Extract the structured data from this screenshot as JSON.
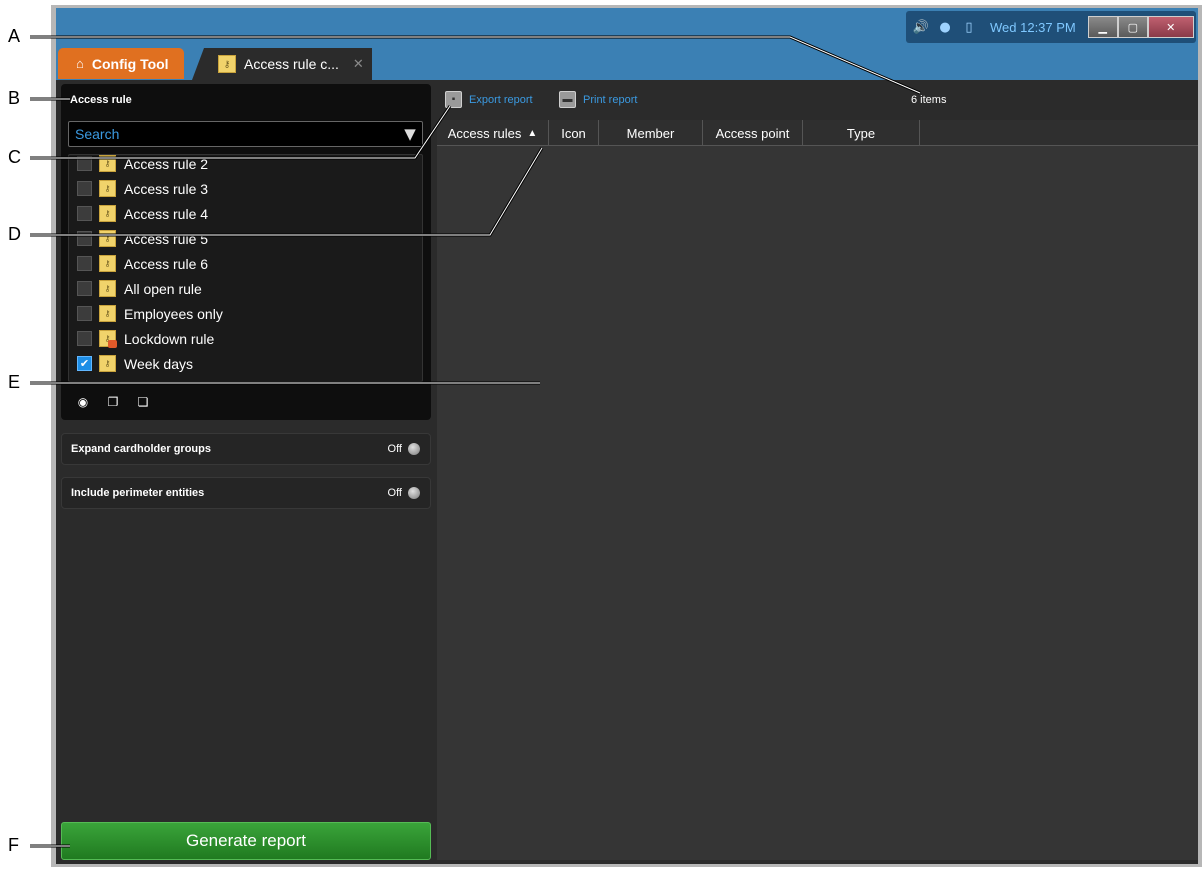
{
  "callouts": [
    "A",
    "B",
    "C",
    "D",
    "E",
    "F"
  ],
  "system": {
    "clock": "Wed 12:37 PM"
  },
  "tabs": {
    "home_label": "Config Tool",
    "task_label": "Access rule c...",
    "close_glyph": "✕"
  },
  "left": {
    "section_title": "Access rule",
    "search_placeholder": "Search",
    "rules": [
      {
        "label": "Access rule 2",
        "checked": false
      },
      {
        "label": "Access rule 3",
        "checked": false
      },
      {
        "label": "Access rule 4",
        "checked": false
      },
      {
        "label": "Access rule 5",
        "checked": false
      },
      {
        "label": "Access rule 6",
        "checked": false
      },
      {
        "label": "All open rule",
        "checked": false
      },
      {
        "label": "Employees only",
        "checked": false
      },
      {
        "label": "Lockdown rule",
        "checked": false
      },
      {
        "label": "Week days",
        "checked": true
      }
    ],
    "options": [
      {
        "label": "Expand cardholder groups",
        "value": "Off"
      },
      {
        "label": "Include perimeter entities",
        "value": "Off"
      }
    ],
    "generate_label": "Generate report"
  },
  "report": {
    "export_label": "Export report",
    "print_label": "Print report",
    "item_count": "6 items",
    "columns": [
      "Access rules",
      "Icon",
      "Member",
      "Access point",
      "Type"
    ]
  },
  "colors": {
    "titlebar": "#3b80b4",
    "config_tab": "#e07020",
    "generate": "#2e8f2e",
    "link_blue": "#3b9ae1"
  }
}
